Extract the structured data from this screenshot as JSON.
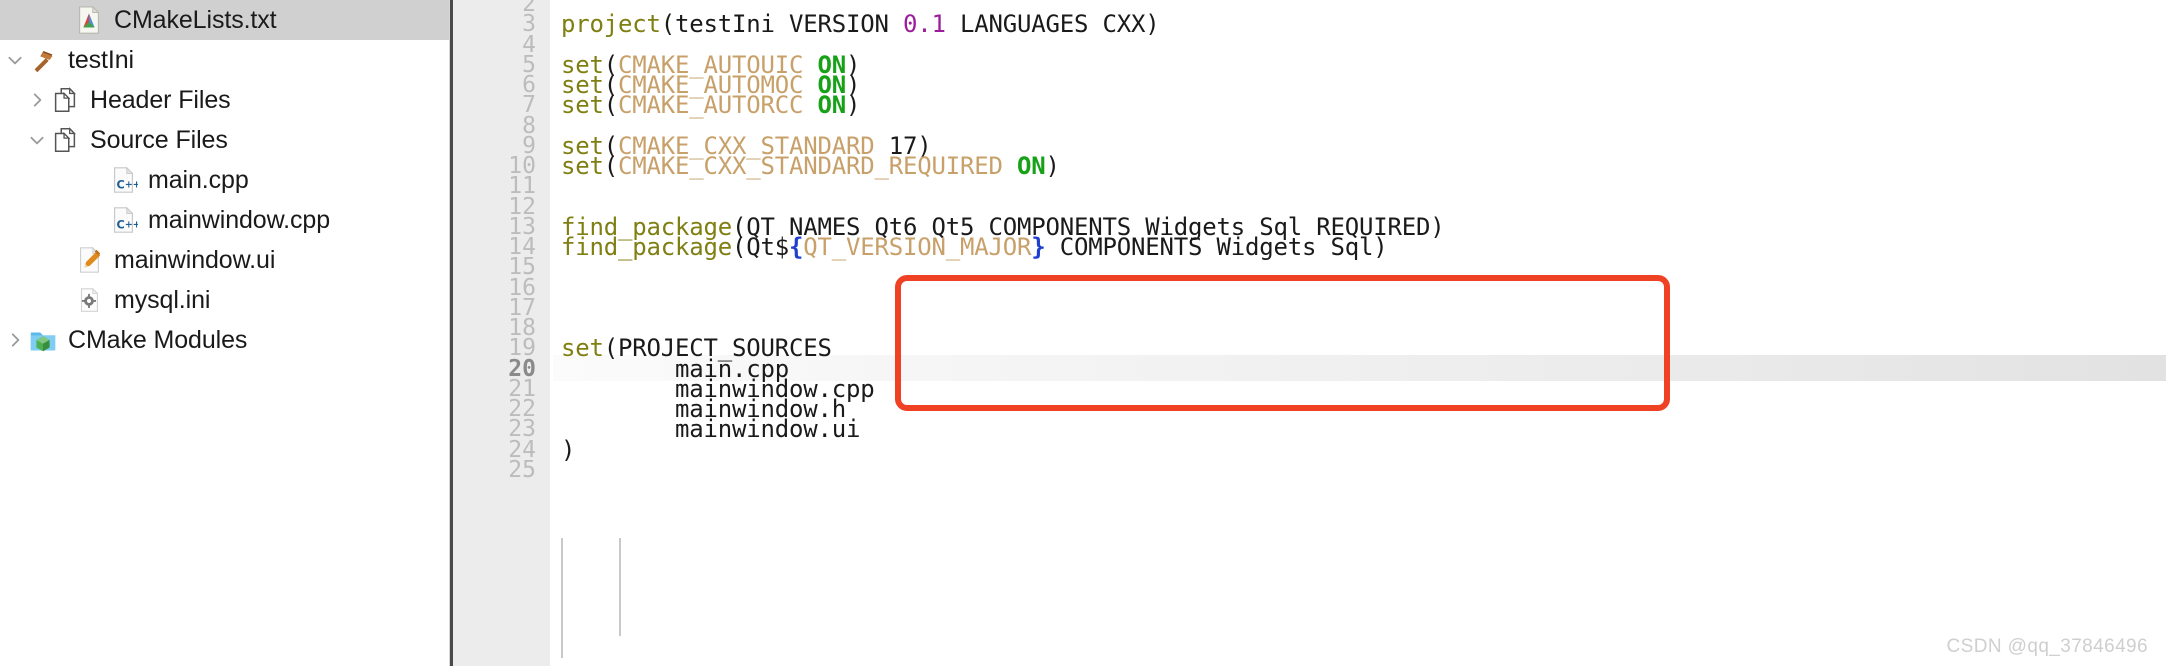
{
  "sidebar": {
    "items": [
      {
        "label": "CMakeLists.txt",
        "icon": "cmake-file-icon",
        "indent": 2,
        "twisty": "none",
        "selected": true
      },
      {
        "label": "testIni",
        "icon": "hammer-icon",
        "indent": 0,
        "twisty": "expanded",
        "selected": false
      },
      {
        "label": "Header Files",
        "icon": "documents-icon",
        "indent": 1,
        "twisty": "collapsed",
        "selected": false
      },
      {
        "label": "Source Files",
        "icon": "documents-icon",
        "indent": 1,
        "twisty": "expanded",
        "selected": false
      },
      {
        "label": "main.cpp",
        "icon": "cpp-file-icon",
        "indent": 3,
        "twisty": "none",
        "selected": false
      },
      {
        "label": "mainwindow.cpp",
        "icon": "cpp-file-icon",
        "indent": 3,
        "twisty": "none",
        "selected": false
      },
      {
        "label": "mainwindow.ui",
        "icon": "ui-pencil-icon",
        "indent": 2,
        "twisty": "none",
        "selected": false
      },
      {
        "label": "mysql.ini",
        "icon": "gear-file-icon",
        "indent": 2,
        "twisty": "none",
        "selected": false
      },
      {
        "label": "CMake Modules",
        "icon": "cmake-folder-icon",
        "indent": 0,
        "twisty": "collapsed",
        "selected": false
      }
    ]
  },
  "editor": {
    "current_line": 20,
    "first_visible_line": 2,
    "last_visible_line": 25,
    "lines": [
      {
        "n": 2,
        "text": ""
      },
      {
        "n": 3,
        "text": "project(testIni VERSION 0.1 LANGUAGES CXX)"
      },
      {
        "n": 4,
        "text": ""
      },
      {
        "n": 5,
        "text": "set(CMAKE_AUTOUIC ON)"
      },
      {
        "n": 6,
        "text": "set(CMAKE_AUTOMOC ON)"
      },
      {
        "n": 7,
        "text": "set(CMAKE_AUTORCC ON)"
      },
      {
        "n": 8,
        "text": ""
      },
      {
        "n": 9,
        "text": "set(CMAKE_CXX_STANDARD 17)"
      },
      {
        "n": 10,
        "text": "set(CMAKE_CXX_STANDARD_REQUIRED ON)"
      },
      {
        "n": 11,
        "text": ""
      },
      {
        "n": 12,
        "text": ""
      },
      {
        "n": 13,
        "text": "find_package(QT NAMES Qt6 Qt5 COMPONENTS Widgets Sql REQUIRED)"
      },
      {
        "n": 14,
        "text": "find_package(Qt${QT_VERSION_MAJOR} COMPONENTS Widgets Sql)"
      },
      {
        "n": 15,
        "text": ""
      },
      {
        "n": 16,
        "text": ""
      },
      {
        "n": 17,
        "text": ""
      },
      {
        "n": 18,
        "text": ""
      },
      {
        "n": 19,
        "text": "set(PROJECT_SOURCES"
      },
      {
        "n": 20,
        "text": "        main.cpp"
      },
      {
        "n": 21,
        "text": "        mainwindow.cpp"
      },
      {
        "n": 22,
        "text": "        mainwindow.h"
      },
      {
        "n": 23,
        "text": "        mainwindow.ui"
      },
      {
        "n": 24,
        "text": ")"
      },
      {
        "n": 25,
        "text": ""
      }
    ],
    "tokens": {
      "l3": [
        {
          "t": "project",
          "c": "cmd"
        },
        {
          "t": "(testIni VERSION ",
          "c": "plain"
        },
        {
          "t": "0.1",
          "c": "num"
        },
        {
          "t": " LANGUAGES CXX)",
          "c": "plain"
        }
      ],
      "l5": [
        {
          "t": "set",
          "c": "cmd"
        },
        {
          "t": "(",
          "c": "plain"
        },
        {
          "t": "CMAKE_AUTOUIC ",
          "c": "var"
        },
        {
          "t": "ON",
          "c": "on"
        },
        {
          "t": ")",
          "c": "plain"
        }
      ],
      "l6": [
        {
          "t": "set",
          "c": "cmd"
        },
        {
          "t": "(",
          "c": "plain"
        },
        {
          "t": "CMAKE_AUTOMOC ",
          "c": "var"
        },
        {
          "t": "ON",
          "c": "on"
        },
        {
          "t": ")",
          "c": "plain"
        }
      ],
      "l7": [
        {
          "t": "set",
          "c": "cmd"
        },
        {
          "t": "(",
          "c": "plain"
        },
        {
          "t": "CMAKE_AUTORCC ",
          "c": "var"
        },
        {
          "t": "ON",
          "c": "on"
        },
        {
          "t": ")",
          "c": "plain"
        }
      ],
      "l9": [
        {
          "t": "set",
          "c": "cmd"
        },
        {
          "t": "(",
          "c": "plain"
        },
        {
          "t": "CMAKE_CXX_STANDARD ",
          "c": "var"
        },
        {
          "t": "17",
          "c": "plain"
        },
        {
          "t": ")",
          "c": "plain"
        }
      ],
      "l10": [
        {
          "t": "set",
          "c": "cmd"
        },
        {
          "t": "(",
          "c": "plain"
        },
        {
          "t": "CMAKE_CXX_STANDARD_REQUIRED ",
          "c": "var"
        },
        {
          "t": "ON",
          "c": "on"
        },
        {
          "t": ")",
          "c": "plain"
        }
      ],
      "l13": [
        {
          "t": "find_package",
          "c": "cmd"
        },
        {
          "t": "(QT NAMES Qt6 Qt5 COMPONENTS Widgets Sql REQUIRED)",
          "c": "plain"
        }
      ],
      "l14": [
        {
          "t": "find_package",
          "c": "cmd"
        },
        {
          "t": "(Qt$",
          "c": "plain"
        },
        {
          "t": "{",
          "c": "brace"
        },
        {
          "t": "QT_VERSION_MAJOR",
          "c": "var"
        },
        {
          "t": "}",
          "c": "brace"
        },
        {
          "t": " COMPONENTS Widgets Sql)",
          "c": "plain"
        }
      ],
      "l19": [
        {
          "t": "set",
          "c": "cmd"
        },
        {
          "t": "(PROJECT_SOURCES",
          "c": "plain"
        }
      ],
      "l20": [
        {
          "t": "        main.cpp",
          "c": "plain"
        }
      ],
      "l21": [
        {
          "t": "        mainwindow.cpp",
          "c": "plain"
        }
      ],
      "l22": [
        {
          "t": "        mainwindow.h",
          "c": "plain"
        }
      ],
      "l23": [
        {
          "t": "        mainwindow.ui",
          "c": "plain"
        }
      ],
      "l24": [
        {
          "t": ")",
          "c": "plain"
        }
      ]
    }
  },
  "annotation": {
    "shape": "rounded-rectangle",
    "color": "#ef4123",
    "covers_lines": "12-16",
    "highlighted_text": [
      "find_package(QT NAMES Qt6 Qt5 COMPONENTS Widgets Sql REQUIRED)",
      "find_package(Qt${QT_VERSION_MAJOR} COMPONENTS Widgets Sql)"
    ]
  },
  "watermark": {
    "text": "CSDN @qq_37846496"
  },
  "colors": {
    "command": "#7f7f13",
    "variable": "#c8a06a",
    "on_keyword": "#17a117",
    "number": "#9b1d9b",
    "brace": "#1f3fd0",
    "annotation": "#ef4123",
    "gutter_bg": "#ececec",
    "selection_bg": "#d0d0d0"
  }
}
